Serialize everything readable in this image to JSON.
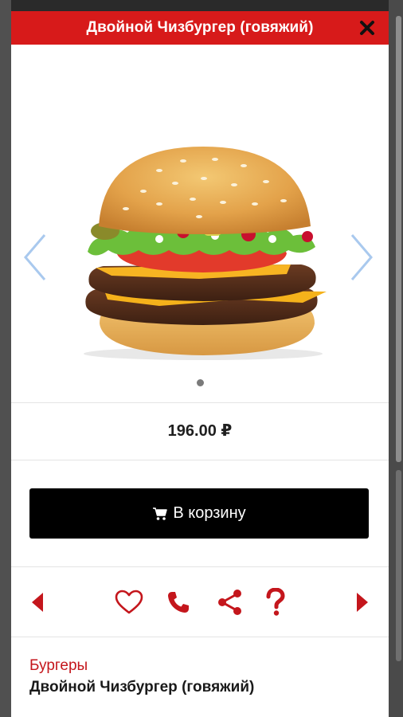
{
  "colors": {
    "header_bg": "#d71a1a",
    "accent": "#c4161c",
    "nav_arrow": "#a9c9ee",
    "cart_bg": "#000000"
  },
  "modal": {
    "title": "Двойной Чизбургер (говяжий)",
    "close_icon": "close-icon"
  },
  "gallery": {
    "image": "double-cheeseburger-photo",
    "prev_icon": "chevron-left-icon",
    "next_icon": "chevron-right-icon",
    "slides_total": 1,
    "current_slide": 1
  },
  "product": {
    "price": "196.00 ₽",
    "category": "Бургеры",
    "name": "Двойной Чизбургер (говяжий)"
  },
  "cart_button": {
    "label": "В корзину",
    "icon": "cart-icon"
  },
  "actions": [
    {
      "name": "prev-product",
      "icon": "triangle-left-icon"
    },
    {
      "name": "favorite",
      "icon": "heart-icon"
    },
    {
      "name": "call",
      "icon": "phone-icon"
    },
    {
      "name": "share",
      "icon": "share-icon"
    },
    {
      "name": "help",
      "icon": "question-icon"
    },
    {
      "name": "next-product",
      "icon": "triangle-right-icon"
    }
  ]
}
